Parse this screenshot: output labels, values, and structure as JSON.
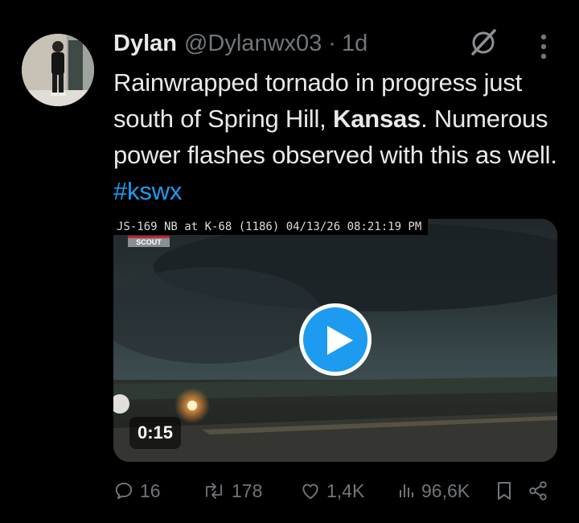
{
  "tweet": {
    "author_name": "Dylan",
    "handle": "@Dylanwx03",
    "separator": "·",
    "time": "1d",
    "text": {
      "part1": "Rainwrapped tornado in progress just south of Spring Hill, ",
      "bold": "Kansas",
      "part2": ". Numerous power flashes observed with this as well. ",
      "hashtag": "#kswx"
    }
  },
  "media": {
    "camera_caption": "JS-169 NB at K-68 (1186) 04/13/26 08:21:19 PM",
    "logo_text": "SCOUT",
    "duration": "0:15"
  },
  "actions": {
    "replies": "16",
    "reposts": "178",
    "likes": "1,4K",
    "views": "96,6K"
  },
  "colors": {
    "background": "#000000",
    "text": "#e7e9ea",
    "secondary": "#71767b",
    "accent": "#1d9bf0"
  },
  "icons": [
    "grok-icon",
    "more-icon",
    "play-icon",
    "reply-icon",
    "repost-icon",
    "like-icon",
    "views-icon",
    "bookmark-icon",
    "share-icon"
  ]
}
